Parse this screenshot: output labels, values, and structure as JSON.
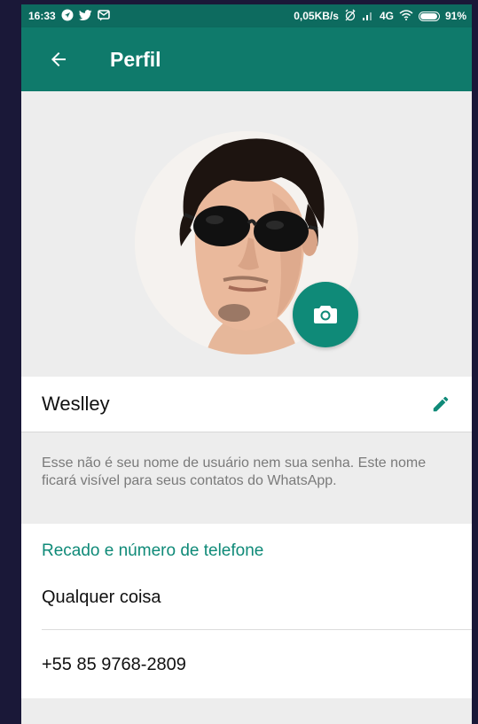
{
  "status_bar": {
    "time": "16:33",
    "left_icons": [
      "navigation-icon",
      "twitter-icon",
      "message-icon"
    ],
    "network_speed": "0,05KB/s",
    "network_type": "4G",
    "battery": "91%",
    "battery_level": 0.91
  },
  "app_bar": {
    "title": "Perfil",
    "back_icon": "arrow-left-icon"
  },
  "profile": {
    "camera_icon": "camera-icon",
    "name": "Weslley",
    "edit_icon": "pencil-icon",
    "name_hint": "Esse não é seu nome de usuário nem sua senha. Este nome ficará visível para seus contatos do WhatsApp."
  },
  "info": {
    "section_title": "Recado e número de telefone",
    "about": "Qualquer coisa",
    "phone": "+55 85 9768-2809"
  },
  "colors": {
    "app_bar": "#0f7a6b",
    "status_bar": "#0d6b5f",
    "accent": "#0f8a78",
    "background": "#ededed"
  }
}
